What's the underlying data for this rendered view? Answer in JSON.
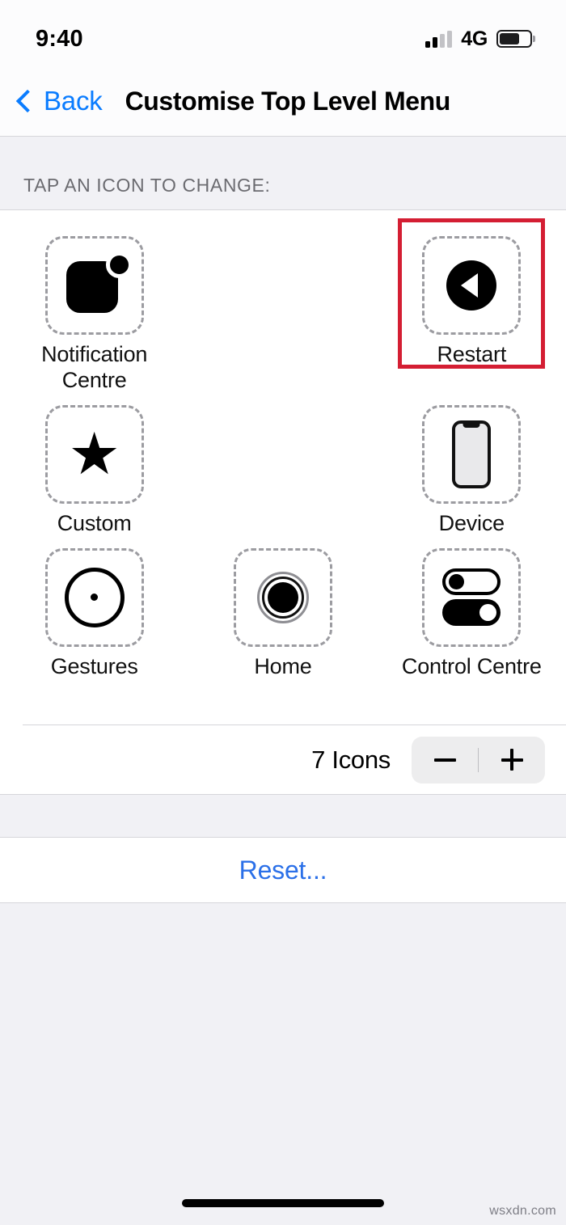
{
  "status_bar": {
    "time": "9:40",
    "network_label": "4G",
    "signal_icon": "cellular-signal-icon",
    "signal_bars_active": 2,
    "signal_bars_total": 4,
    "battery_icon": "battery-icon",
    "battery_level_percent": 66
  },
  "nav_bar": {
    "back_label": "Back",
    "back_icon": "chevron-left-icon",
    "title": "Customise Top Level Menu"
  },
  "section": {
    "header": "TAP AN ICON TO CHANGE:"
  },
  "grid": {
    "rows": [
      [
        {
          "label": "Notification Centre",
          "icon": "notification-centre-icon",
          "highlighted": false
        },
        {
          "label": "",
          "icon": "",
          "empty": true
        },
        {
          "label": "Restart",
          "icon": "restart-icon",
          "highlighted": true
        }
      ],
      [
        {
          "label": "Custom",
          "icon": "star-icon",
          "highlighted": false
        },
        {
          "label": "",
          "icon": "",
          "empty": true
        },
        {
          "label": "Device",
          "icon": "device-icon",
          "highlighted": false
        }
      ],
      [
        {
          "label": "Gestures",
          "icon": "gestures-icon",
          "highlighted": false
        },
        {
          "label": "Home",
          "icon": "home-button-icon",
          "highlighted": false
        },
        {
          "label": "Control Centre",
          "icon": "control-centre-icon",
          "highlighted": false
        }
      ]
    ]
  },
  "stepper": {
    "count_label": "7 Icons",
    "minus_icon": "minus-icon",
    "plus_icon": "plus-icon"
  },
  "reset": {
    "label": "Reset..."
  },
  "footer": {
    "watermark": "wsxdn.com",
    "home_indicator": "home-indicator"
  },
  "colors": {
    "accent_blue": "#0a7cff",
    "reset_blue": "#2b70e8",
    "highlight_red": "#d41e33",
    "grouped_background": "#f1f1f5",
    "card_background": "#ffffff",
    "dashed_border": "#9c9ca1"
  }
}
